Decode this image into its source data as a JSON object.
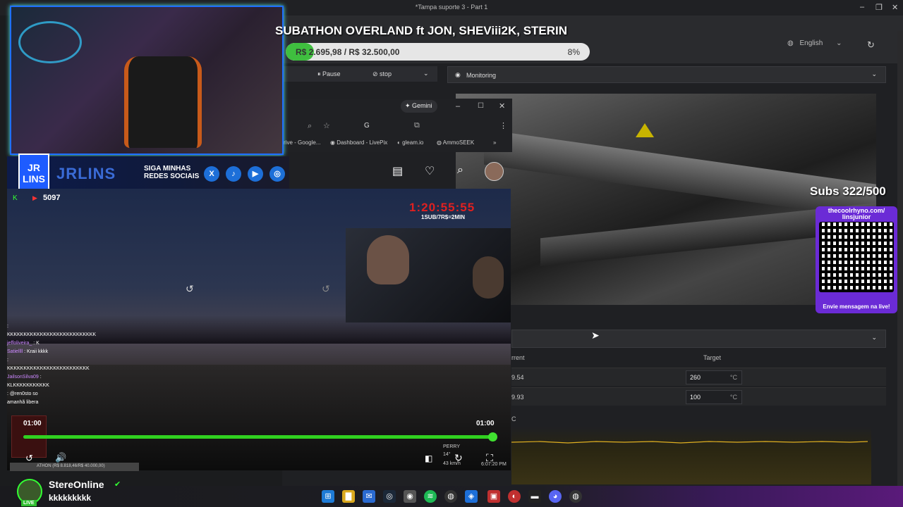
{
  "window": {
    "title": "*Tampa suporte 3 - Part 1"
  },
  "stream": {
    "subathon_title": "SUBATHON OVERLAND ft JON, SHEViii2K, STERIN",
    "progress_text": "R$ 2.695,98 / R$ 32.500,00",
    "progress_percent_label": "8%",
    "progress_fraction": 0.08,
    "brand_name": "JRLINS",
    "brand_logo": "JR LINS",
    "siga_line1": "SIGA MINHAS",
    "siga_line2": "REDES SOCIAIS",
    "viewer_count": "5097",
    "timer": "1:20:55:55",
    "timer_rate": "1SUB/7R$=2MIN",
    "subs": "Subs 322/500",
    "qr_link": "thecoolrhyno.com/ linsjunior",
    "qr_message": "Envie mensagem na live!",
    "seek_start": "01:00",
    "seek_end": "01:00",
    "bottom_progress": "ATHON (R$ 8.818,46/R$ 40.000,00)",
    "profile_name": "StereOnline",
    "profile_msg": "kkkkkkkkk",
    "live_badge": "LIVE",
    "pip_overlay": "PERRY",
    "pip_temp": "14°",
    "pip_speed": "43 km/h",
    "pip_time": "6:07:20 PM"
  },
  "chat": [
    {
      "user": "",
      "msg": ":"
    },
    {
      "user": "",
      "msg": "KKKKKKKKKKKKKKKKKKKKKKKKKKK"
    },
    {
      "user": "jeffoliveira_",
      "msg": ": K"
    },
    {
      "user": "Satiellll",
      "msg": ": Kraii kkkk"
    },
    {
      "user": "",
      "msg": ":"
    },
    {
      "user": "",
      "msg": "KKKKKKKKKKKKKKKKKKKKKKKKK"
    },
    {
      "user": "JailsonSilva09",
      "msg": ":"
    },
    {
      "user": "",
      "msg": "KLKKKKKKKKKKK"
    },
    {
      "user": "",
      "msg": ": @ren0sto so"
    },
    {
      "user": "",
      "msg": "amanhã libera"
    }
  ],
  "app": {
    "language": "English",
    "pause_label": "Pause",
    "stop_label": "stop",
    "monitoring_label": "Monitoring",
    "col_current": "rrent",
    "col_target": "Target",
    "rows": [
      {
        "current": "9.54",
        "target": "260",
        "unit": "°C"
      },
      {
        "current": "9.93",
        "target": "100",
        "unit": "°C"
      }
    ],
    "chart_axis": "C"
  },
  "browser": {
    "gemini_label": "Gemini",
    "bookmarks": [
      "rive - Google...",
      "Dashboard - LivePix",
      "gleam.io",
      "AmmoSEEK"
    ]
  },
  "colors": {
    "accent_green": "#3fbf3f",
    "timer_red": "#e02020",
    "qr_purple": "#6b2bd6",
    "webcam_border": "#1e6fff"
  }
}
